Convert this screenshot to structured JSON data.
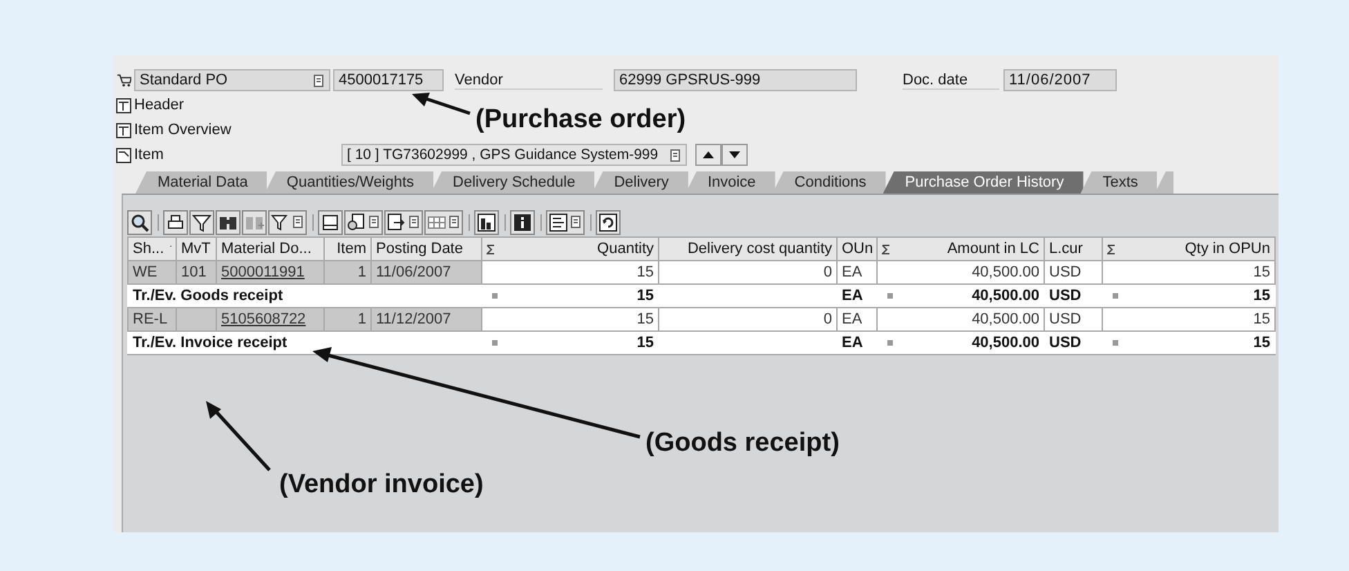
{
  "header": {
    "doc_type": "Standard PO",
    "po_number": "4500017175",
    "vendor_label": "Vendor",
    "vendor": "62999 GPSRUS-999",
    "date_label": "Doc. date",
    "doc_date": "11/06/2007"
  },
  "sections": [
    {
      "label": "Header",
      "kind": "toggle"
    },
    {
      "label": "Item Overview",
      "kind": "toggle"
    },
    {
      "label": "Item",
      "kind": "item",
      "value": "[ 10 ] TG73602999 , GPS Guidance System-999"
    }
  ],
  "tabs": [
    {
      "label": "Material Data",
      "selected": false
    },
    {
      "label": "Quantities/Weights",
      "selected": false
    },
    {
      "label": "Delivery Schedule",
      "selected": false
    },
    {
      "label": "Delivery",
      "selected": false
    },
    {
      "label": "Invoice",
      "selected": false
    },
    {
      "label": "Conditions",
      "selected": false
    },
    {
      "label": "Purchase Order History",
      "selected": true
    },
    {
      "label": "Texts",
      "selected": false
    }
  ],
  "table": {
    "columns": [
      {
        "label": "Sh...",
        "kind": "text",
        "key": true,
        "sorted": true
      },
      {
        "label": "MvT",
        "kind": "text",
        "key": true
      },
      {
        "label": "Material Do...",
        "kind": "text",
        "key": true,
        "link": true
      },
      {
        "label": "Item",
        "kind": "number",
        "key": true
      },
      {
        "label": "Posting Date",
        "kind": "text",
        "key": true
      },
      {
        "label": "Quantity",
        "kind": "number",
        "sum": true
      },
      {
        "label": "Delivery cost quantity",
        "kind": "number"
      },
      {
        "label": "OUn",
        "kind": "text"
      },
      {
        "label": "Amount in LC",
        "kind": "number",
        "sum": true
      },
      {
        "label": "L.cur",
        "kind": "text"
      },
      {
        "label": "Qty in OPUn",
        "kind": "number",
        "sum": true
      }
    ],
    "rows": [
      {
        "kind": "item",
        "cells": [
          "WE",
          "101",
          "5000011991",
          "1",
          "11/06/2007",
          "15",
          "0",
          "EA",
          "40,500.00",
          "USD",
          "15"
        ]
      },
      {
        "kind": "total",
        "label": "Tr./Ev. Goods receipt",
        "cells": [
          "15",
          null,
          "EA",
          "40,500.00",
          "USD",
          "15"
        ]
      },
      {
        "kind": "item",
        "cells": [
          "RE-L",
          null,
          "5105608722",
          "1",
          "11/12/2007",
          "15",
          "0",
          "EA",
          "40,500.00",
          "USD",
          "15"
        ]
      },
      {
        "kind": "total",
        "label": "Tr./Ev. Invoice receipt",
        "cells": [
          "15",
          null,
          "EA",
          "40,500.00",
          "USD",
          "15"
        ]
      }
    ]
  },
  "annotations": [
    {
      "text": "(Purchase order)"
    },
    {
      "text": "(Goods receipt)"
    },
    {
      "text": "(Vendor invoice)"
    }
  ]
}
